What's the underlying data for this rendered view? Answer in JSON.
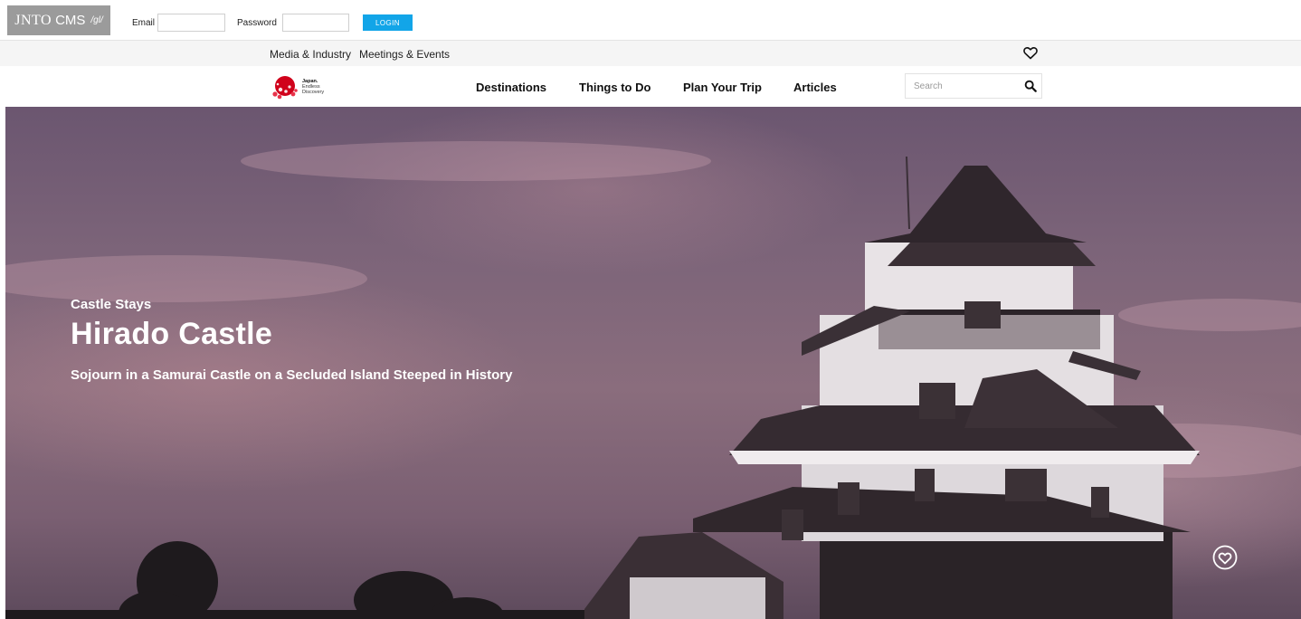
{
  "cms_bar": {
    "logo_jnto": "JNTO",
    "logo_cms": "CMS",
    "logo_path": "/gl/",
    "email_label": "Email",
    "email_value": "",
    "password_label": "Password",
    "password_value": "",
    "login_label": "LOGIN",
    "login_color": "#12a5e8"
  },
  "utility_bar": {
    "links": [
      "Media & Industry",
      "Meetings & Events"
    ],
    "favorites_icon": "heart-outline-icon"
  },
  "main_nav": {
    "logo": {
      "mark_icon": "japan-cherry-blossom-logo",
      "line1": "Japan.",
      "line2": "Endless",
      "line3": "Discovery"
    },
    "items": [
      "Destinations",
      "Things to Do",
      "Plan Your Trip",
      "Articles"
    ],
    "search_placeholder": "Search",
    "search_icon": "magnifier-icon"
  },
  "hero": {
    "category": "Castle Stays",
    "title": "Hirado Castle",
    "subtitle": "Sojourn in a Samurai Castle on a Secluded Island Steeped in History",
    "favorite_icon": "heart-circle-icon"
  }
}
